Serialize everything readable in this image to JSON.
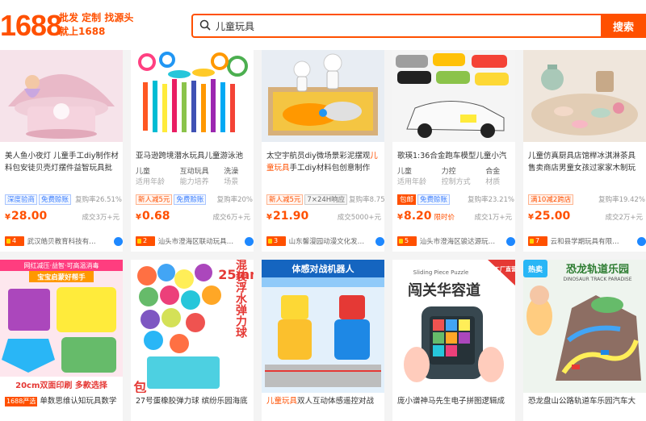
{
  "header": {
    "logo": "1688",
    "slogan_line1": "批发 定制 找源头",
    "slogan_line2": "就上1688",
    "search_value": "儿童玩具",
    "search_button": "搜索"
  },
  "products_row1": [
    {
      "title": "美人鱼小夜灯 儿童手工diy制作材料包安徒贝壳灯摆件益智玩具批发",
      "attrs": [],
      "tags": [
        {
          "text": "深度验商",
          "style": "blue"
        },
        {
          "text": "免费赊账",
          "style": "blue"
        }
      ],
      "rebuy": "复购率26.51%",
      "price": "28.00",
      "limit": "",
      "sold": "成交3万+元",
      "years": "4年",
      "shop": "武汉皓贝教育科技有…"
    },
    {
      "title": "亚马逊跨境潜水玩具儿童游泳池潜水鱼",
      "attrs": [
        {
          "v": "儿童",
          "k": "适用年龄"
        },
        {
          "v": "互动玩具",
          "k": "能力培养"
        },
        {
          "v": "洗澡",
          "k": "场景"
        }
      ],
      "tags": [
        {
          "text": "新人减5元",
          "style": "orange"
        },
        {
          "text": "免费赊账",
          "style": "blue"
        }
      ],
      "rebuy": "复购率20%",
      "price": "0.68",
      "limit": "",
      "sold": "成交6万+元",
      "years": "2年",
      "shop": "汕头市澄海区联动玩具…"
    },
    {
      "title_hl_before": "太空宇航员diy微场景彩泥摆观",
      "title_hl": "儿童玩具",
      "title_hl_after": "手工diy材料包创意制作",
      "attrs": [],
      "tags": [
        {
          "text": "新人减5元",
          "style": "orange"
        },
        {
          "text": "7×24H响应",
          "style": "gray"
        }
      ],
      "rebuy": "复购率8.75%",
      "price": "21.90",
      "limit": "",
      "sold": "成交5000+元",
      "years": "3年",
      "shop": "山东馨漫园动漫文化发…"
    },
    {
      "title": "歌瑛1:36合金跑车模型儿童小汽车赛",
      "attrs": [
        {
          "v": "儿童",
          "k": "适用年龄"
        },
        {
          "v": "力控",
          "k": "控制方式"
        },
        {
          "v": "合金",
          "k": "材质"
        }
      ],
      "tags": [
        {
          "text": "包邮",
          "style": "solid"
        },
        {
          "text": "免费赊账",
          "style": "blue"
        }
      ],
      "rebuy": "复购率23.21%",
      "price": "8.20",
      "limit": "限时价",
      "sold": "成交1万+元",
      "years": "5年",
      "shop": "汕头市澄海区骏达源玩…"
    },
    {
      "title": "儿童仿真厨具店馆榉冰淇淋茶具售卖商店男童女孩过家家木制玩具",
      "attrs": [],
      "tags": [
        {
          "text": "满10减2跨店",
          "style": "orange"
        }
      ],
      "rebuy": "复购率19.42%",
      "price": "25.00",
      "limit": "",
      "sold": "成交2万+元",
      "years": "7年",
      "shop": "云和县学期玩具有限…"
    }
  ],
  "products_row2": [
    {
      "brand": "1688严选",
      "title": "单数思维认知玩具数学教"
    },
    {
      "brand": "",
      "title": "27号蛋橡胶弹力球 缤纷乐园海底捞"
    },
    {
      "brand": "",
      "title_hl": "儿童玩具",
      "title": "双人互动体感遥控对战机器"
    },
    {
      "brand": "",
      "title": "庞小谱神马先生电子拼图逻辑成人儿"
    },
    {
      "brand": "",
      "title": "恐龙盘山公路轨道车乐园汽车大冒险"
    }
  ],
  "image_texts": {
    "pop_top": "网红减压·益智·可高温消毒",
    "pop_ribbon": "宝宝启蒙好帮手",
    "pop_bottom": "20cm双面印刷 多款选择",
    "ball_label_1": "25mm",
    "ball_label_2": "混装浮水弹力球",
    "ball_label_3": "包邮",
    "robot_title": "体感对战机器人",
    "puzzle_small": "Sliding Piece Puzzle",
    "puzzle_title": "闯关华容道",
    "puzzle_badge": "工厂直营",
    "dino_title": "恐龙轨道乐园",
    "dino_sub": "DINOSAUR TRACK PARADISE",
    "dino_badge": "热卖"
  },
  "colors": {
    "accent": "#ff5000",
    "blue": "#3d7fff"
  }
}
